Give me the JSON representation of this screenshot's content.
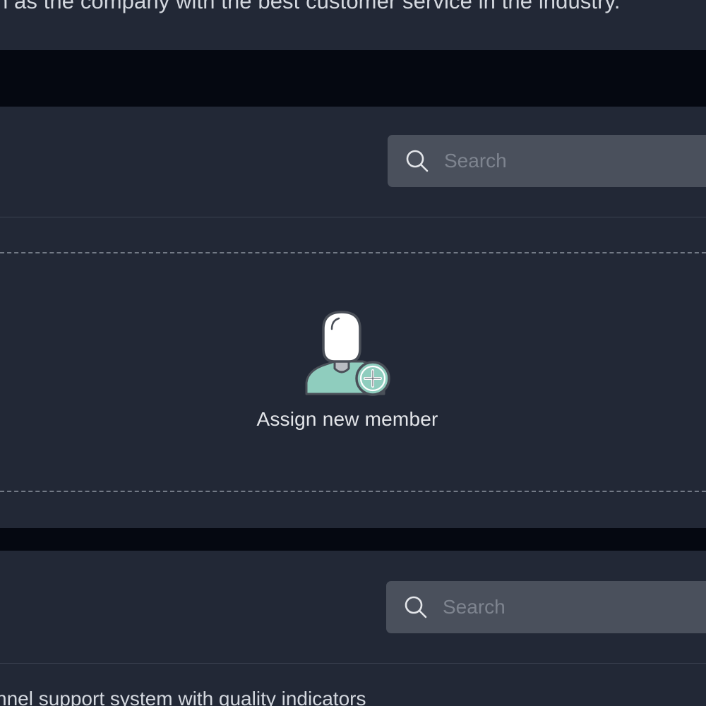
{
  "intro": {
    "text": "n as the company with the best customer service in the industry."
  },
  "panel_top": {
    "search": {
      "placeholder": "Search",
      "value": "",
      "icon": "search-icon"
    }
  },
  "empty_state": {
    "icon": "add-user-icon",
    "label": "Assign new member",
    "icon_colors": {
      "shirt": "#8fcdbe",
      "head": "#ffffff",
      "outline": "#4a4f58"
    }
  },
  "panel_bottom": {
    "search": {
      "placeholder": "Search",
      "value": "",
      "icon": "search-icon"
    },
    "description": "nnel support system with quality indicators"
  },
  "colors": {
    "background": "#222836",
    "band": "#050811",
    "search_bg": "#4a505c",
    "placeholder": "#7e848f",
    "text": "#e4e6ea"
  }
}
